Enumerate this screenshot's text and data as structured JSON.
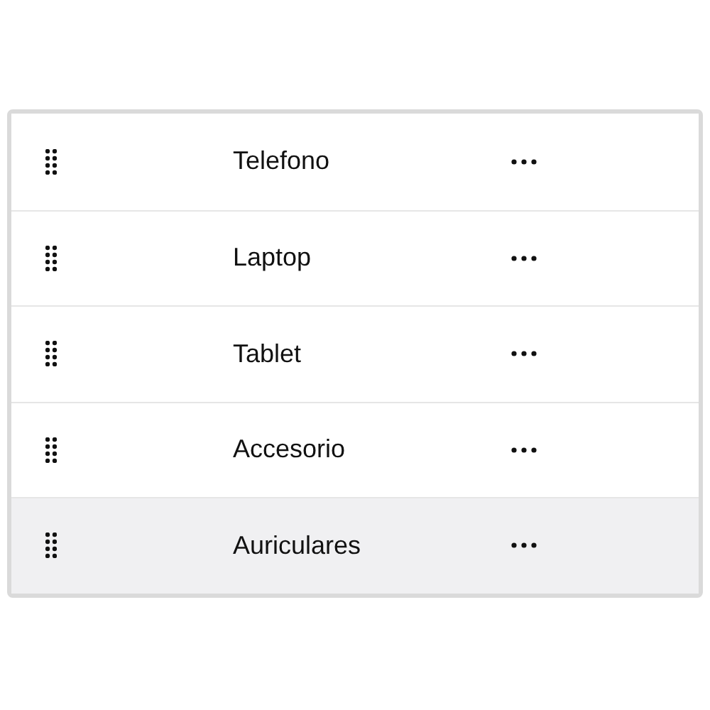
{
  "rows": [
    {
      "label": "Telefono",
      "selected": false
    },
    {
      "label": "Laptop",
      "selected": false
    },
    {
      "label": "Tablet",
      "selected": false
    },
    {
      "label": "Accesorio",
      "selected": false
    },
    {
      "label": "Auriculares",
      "selected": true
    }
  ]
}
